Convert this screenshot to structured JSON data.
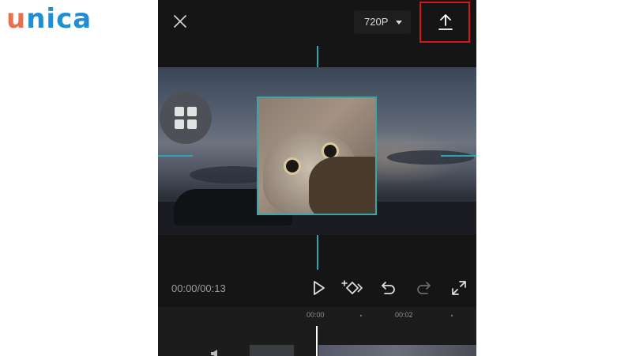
{
  "branding": {
    "logo_first": "u",
    "logo_rest": "nica",
    "color_first": "#e8704a",
    "color_rest": "#1e8fd6"
  },
  "topbar": {
    "close_icon": "close-icon",
    "resolution": {
      "value": "720P",
      "icon": "caret-down-icon"
    },
    "export_icon": "upload-icon",
    "highlight_color": "#d7161b"
  },
  "preview": {
    "layout_icon": "grid-icon",
    "guide_color": "#2ba6b0"
  },
  "controls": {
    "timecode": "00:00/00:13",
    "icons": [
      "play-icon",
      "keyframe-add-icon",
      "undo-icon",
      "redo-icon",
      "fullscreen-icon"
    ]
  },
  "timeline": {
    "ticks": [
      "00:00",
      "00:02"
    ]
  }
}
